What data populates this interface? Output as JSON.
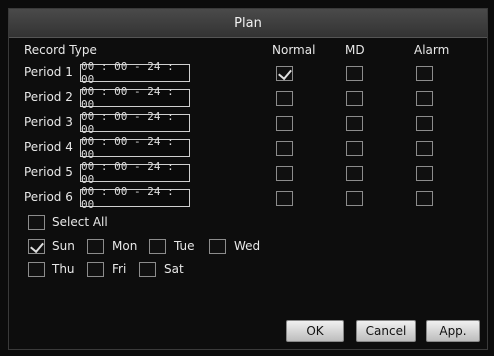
{
  "window": {
    "title": "Plan"
  },
  "header": {
    "record_type": "Record Type",
    "normal": "Normal",
    "md": "MD",
    "alarm": "Alarm"
  },
  "periods": [
    {
      "label": "Period 1",
      "time": "00 : 00 - 24 : 00",
      "normal": true,
      "md": false,
      "alarm": false
    },
    {
      "label": "Period 2",
      "time": "00 : 00 - 24 : 00",
      "normal": false,
      "md": false,
      "alarm": false
    },
    {
      "label": "Period 3",
      "time": "00 : 00 - 24 : 00",
      "normal": false,
      "md": false,
      "alarm": false
    },
    {
      "label": "Period 4",
      "time": "00 : 00 - 24 : 00",
      "normal": false,
      "md": false,
      "alarm": false
    },
    {
      "label": "Period 5",
      "time": "00 : 00 - 24 : 00",
      "normal": false,
      "md": false,
      "alarm": false
    },
    {
      "label": "Period 6",
      "time": "00 : 00 - 24 : 00",
      "normal": false,
      "md": false,
      "alarm": false
    }
  ],
  "select_all": {
    "label": "Select All",
    "checked": false
  },
  "days": [
    {
      "label": "Sun",
      "checked": true
    },
    {
      "label": "Mon",
      "checked": false
    },
    {
      "label": "Tue",
      "checked": false
    },
    {
      "label": "Wed",
      "checked": false
    },
    {
      "label": "Thu",
      "checked": false
    },
    {
      "label": "Fri",
      "checked": false
    },
    {
      "label": "Sat",
      "checked": false
    }
  ],
  "buttons": {
    "ok": "OK",
    "cancel": "Cancel",
    "apply": "App."
  }
}
